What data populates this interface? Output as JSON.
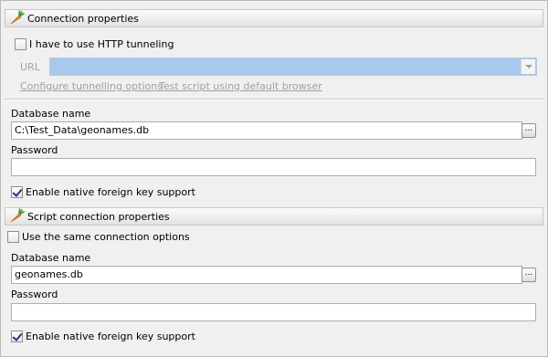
{
  "connection": {
    "header": "Connection properties",
    "http_tunneling_label": "I have to use HTTP tunneling",
    "http_tunneling_checked": false,
    "url_label": "URL",
    "url_value": "",
    "configure_link": "Configure tunnelling options",
    "test_script_link": "Test script using default browser",
    "db_name_label": "Database name",
    "db_name_value": "C:\\Test_Data\\geonames.db",
    "password_label": "Password",
    "password_value": "",
    "fk_label": "Enable native foreign key support",
    "fk_checked": true,
    "browse_label": "..."
  },
  "script": {
    "header": "Script connection properties",
    "same_options_label": "Use the same connection options",
    "same_options_checked": false,
    "db_name_label": "Database name",
    "db_name_value": "geonames.db",
    "password_label": "Password",
    "password_value": "",
    "fk_label": "Enable native foreign key support",
    "fk_checked": true,
    "browse_label": "..."
  },
  "icons": {
    "section_icon": "carrot-icon",
    "dropdown": "chevron-down-icon"
  },
  "colors": {
    "url_combo_disabled": "#a9c8ed",
    "header_border": "#c8c8c8"
  }
}
